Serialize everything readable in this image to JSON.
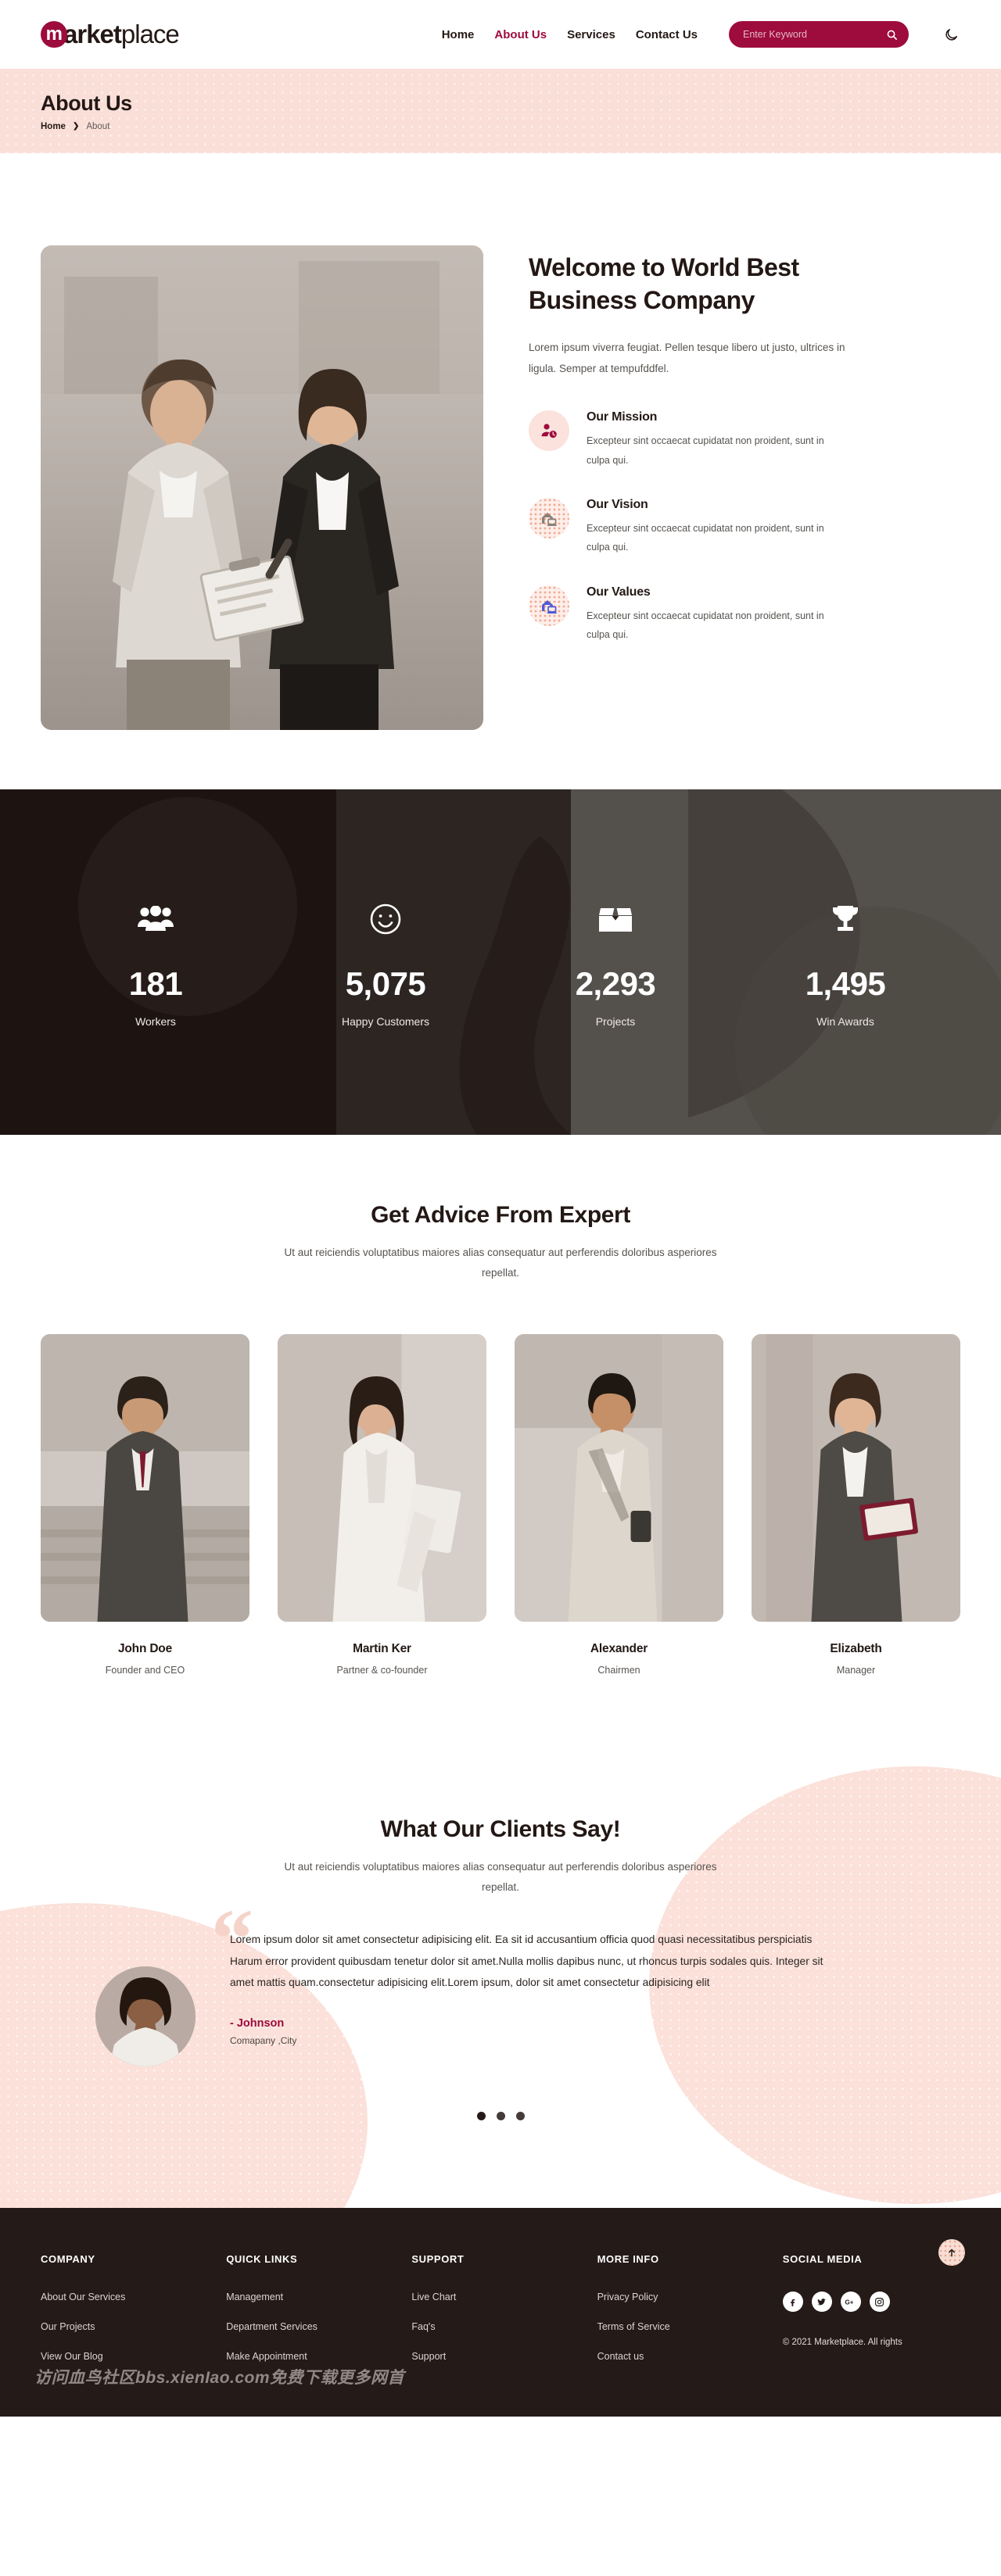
{
  "header": {
    "logo": {
      "badge": "m",
      "bold": "arket",
      "light": "place"
    },
    "nav": [
      {
        "label": "Home",
        "active": false
      },
      {
        "label": "About Us",
        "active": true
      },
      {
        "label": "Services",
        "active": false
      },
      {
        "label": "Contact Us",
        "active": false
      }
    ],
    "search": {
      "placeholder": "Enter Keyword",
      "value": "",
      "icon": "search-icon"
    },
    "theme_toggle_icon": "moon-icon",
    "accent": "#9e0b3d"
  },
  "hero": {
    "title": "About Us",
    "breadcrumb": {
      "home": "Home",
      "separator": "›",
      "current": "About"
    }
  },
  "welcome": {
    "heading": "Welcome to World Best Business Company",
    "lead": "Lorem ipsum viverra feugiat. Pellen tesque libero ut justo, ultrices in ligula. Semper at tempufddfel.",
    "features": [
      {
        "icon": "users-clock-icon",
        "title": "Our Mission",
        "text": "Excepteur sint occaecat cupidatat non proident, sunt in culpa qui."
      },
      {
        "icon": "home-laptop-icon",
        "title": "Our Vision",
        "text": "Excepteur sint occaecat cupidatat non proident, sunt in culpa qui."
      },
      {
        "icon": "home-screen-icon",
        "title": "Our Values",
        "text": "Excepteur sint occaecat cupidatat non proident, sunt in culpa qui."
      }
    ]
  },
  "counters": [
    {
      "icon": "people-group-icon",
      "value": "181",
      "label": "Workers"
    },
    {
      "icon": "smiley-face-icon",
      "value": "5,075",
      "label": "Happy Customers"
    },
    {
      "icon": "open-box-icon",
      "value": "2,293",
      "label": "Projects"
    },
    {
      "icon": "trophy-icon",
      "value": "1,495",
      "label": "Win Awards"
    }
  ],
  "team": {
    "title": "Get Advice From Expert",
    "subtitle": "Ut aut reiciendis voluptatibus maiores alias consequatur aut perferendis doloribus asperiores repellat.",
    "members": [
      {
        "name": "John Doe",
        "role": "Founder and CEO"
      },
      {
        "name": "Martin Ker",
        "role": "Partner & co-founder"
      },
      {
        "name": "Alexander",
        "role": "Chairmen"
      },
      {
        "name": "Elizabeth",
        "role": "Manager"
      }
    ]
  },
  "testimonial": {
    "title": "What Our Clients Say!",
    "subtitle": "Ut aut reiciendis voluptatibus maiores alias consequatur aut perferendis doloribus asperiores repellat.",
    "quote": "Lorem ipsum dolor sit amet consectetur adipisicing elit. Ea sit id accusantium officia quod quasi necessitatibus perspiciatis Harum error provident quibusdam tenetur dolor sit amet.Nulla mollis dapibus nunc, ut rhoncus turpis sodales quis. Integer sit amet mattis quam.consectetur adipisicing elit.Lorem ipsum, dolor sit amet consectetur adipisicing elit",
    "author": "- Johnson",
    "company": "Comapany ,City",
    "dots": 3,
    "active_dot": 0
  },
  "footer": {
    "columns": [
      {
        "heading": "COMPANY",
        "links": [
          "About Our Services",
          "Our Projects",
          "View Our Blog"
        ]
      },
      {
        "heading": "QUICK LINKS",
        "links": [
          "Management",
          "Department Services",
          "Make Appointment"
        ]
      },
      {
        "heading": "SUPPORT",
        "links": [
          "Live Chart",
          "Faq's",
          "Support"
        ]
      },
      {
        "heading": "MORE INFO",
        "links": [
          "Privacy Policy",
          "Terms of Service",
          "Contact us"
        ]
      }
    ],
    "social": {
      "heading": "SOCIAL MEDIA",
      "icons": [
        "facebook-icon",
        "twitter-icon",
        "google-plus-icon",
        "instagram-icon"
      ]
    },
    "copyright": "© 2021 Marketplace. All rights",
    "back_to_top_icon": "arrow-up-icon"
  },
  "watermark": "访问血鸟社区bbs.xienIao.com免费下载更多网首"
}
